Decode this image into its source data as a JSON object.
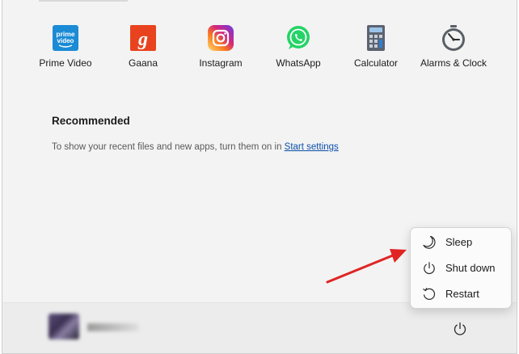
{
  "pinned_apps": [
    {
      "label": "Prime Video",
      "icon": "prime-video-icon",
      "icon_text": "prime video"
    },
    {
      "label": "Gaana",
      "icon": "gaana-icon",
      "icon_text": "g"
    },
    {
      "label": "Instagram",
      "icon": "instagram-icon"
    },
    {
      "label": "WhatsApp",
      "icon": "whatsapp-icon"
    },
    {
      "label": "Calculator",
      "icon": "calculator-icon"
    },
    {
      "label": "Alarms & Clock",
      "icon": "alarm-clock-icon"
    }
  ],
  "recommended": {
    "title": "Recommended",
    "text": "To show your recent files and new apps, turn them on in ",
    "link": "Start settings"
  },
  "power_menu": {
    "items": [
      {
        "label": "Sleep",
        "icon": "moon-icon"
      },
      {
        "label": "Shut down",
        "icon": "power-icon"
      },
      {
        "label": "Restart",
        "icon": "restart-icon"
      }
    ]
  },
  "colors": {
    "prime_video": "#1b8bd6",
    "gaana": "#e8431e",
    "whatsapp": "#25d366",
    "arrow": "#e02424",
    "link": "#0b4fa8"
  }
}
